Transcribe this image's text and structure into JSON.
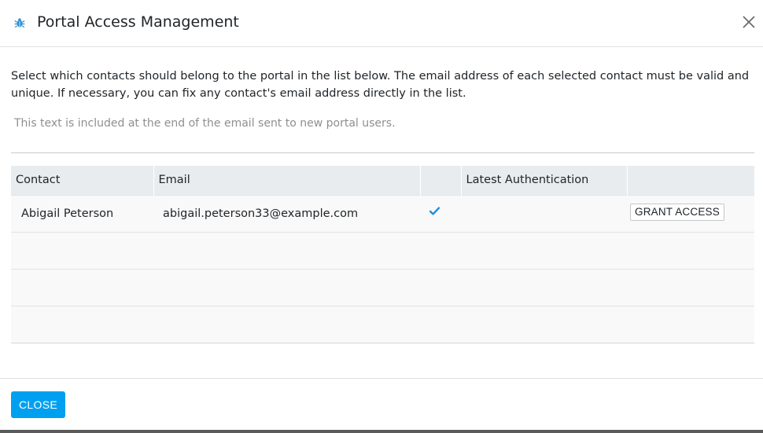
{
  "dialog": {
    "title": "Portal Access Management",
    "intro": "Select which contacts should belong to the portal in the list below. The email address of each selected contact must be valid and unique. If necessary, you can fix any contact's email address directly in the list.",
    "welcome_placeholder": "This text is included at the end of the email sent to new portal users."
  },
  "table": {
    "columns": [
      "Contact",
      "Email",
      "",
      "Latest Authentication",
      ""
    ],
    "rows": [
      {
        "contact": "Abigail Peterson",
        "email": "abigail.peterson33@example.com",
        "verified": true,
        "latest_authentication": "",
        "action_label": "GRANT ACCESS"
      }
    ]
  },
  "footer": {
    "close_label": "CLOSE"
  },
  "colors": {
    "primary": "#00a0f0",
    "check": "#1a8fdb",
    "header_bg": "#e9ecef"
  }
}
